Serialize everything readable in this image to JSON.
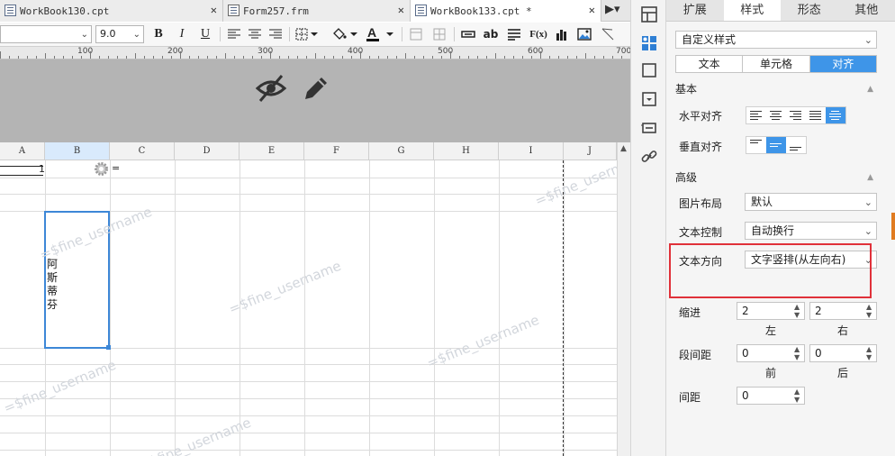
{
  "tabs": [
    {
      "label": "WorkBook130.cpt",
      "active": false
    },
    {
      "label": "Form257.frm",
      "active": false
    },
    {
      "label": "WorkBook133.cpt *",
      "active": true
    }
  ],
  "toolbar": {
    "font_size": "9.0",
    "bold": "B",
    "italic": "I",
    "underline": "U",
    "text_label": "ab",
    "formula_label": "F(x)"
  },
  "ruler": {
    "marks": [
      "100",
      "200",
      "300",
      "400",
      "500",
      "600",
      "700"
    ]
  },
  "columns": [
    "A",
    "B",
    "C",
    "D",
    "E",
    "F",
    "G",
    "H",
    "I",
    "J"
  ],
  "cells": {
    "a1_value": "1",
    "c1_value": "=",
    "b4_vertical": "阿斯蒂芬"
  },
  "watermark": "=$fine_username",
  "panel": {
    "tabs": [
      {
        "label": "扩展",
        "active": false
      },
      {
        "label": "样式",
        "active": true
      },
      {
        "label": "形态",
        "active": false
      },
      {
        "label": "其他",
        "active": false
      }
    ],
    "style_select": "自定义样式",
    "segments": [
      {
        "label": "文本",
        "active": false
      },
      {
        "label": "单元格",
        "active": false
      },
      {
        "label": "对齐",
        "active": true
      }
    ],
    "basic_section": "基本",
    "h_align_label": "水平对齐",
    "v_align_label": "垂直对齐",
    "advanced_section": "高级",
    "image_layout_label": "图片布局",
    "image_layout_value": "默认",
    "text_control_label": "文本控制",
    "text_control_value": "自动换行",
    "text_direction_label": "文本方向",
    "text_direction_value": "文字竖排(从左向右)",
    "indent_label": "缩进",
    "indent_left": "2",
    "indent_right": "2",
    "left_label": "左",
    "right_label": "右",
    "para_spacing_label": "段间距",
    "para_before": "0",
    "para_after": "0",
    "before_label": "前",
    "after_label": "后",
    "spacing_label": "间距",
    "spacing_value": "0"
  },
  "colors": {
    "accent": "#3e95e8",
    "highlight": "#e0313a",
    "selection": "#3d87d7"
  }
}
